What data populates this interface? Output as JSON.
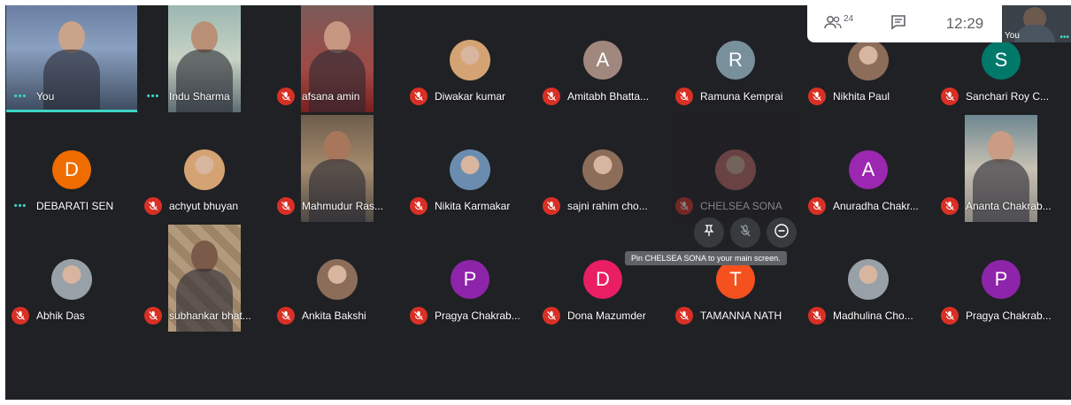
{
  "top_bar": {
    "participant_count": "24",
    "clock": "12:29",
    "self_label": "You",
    "people_icon": "people-icon",
    "chat_icon": "chat-icon"
  },
  "participants": [
    {
      "name": "You",
      "style": "video",
      "indicator": "more",
      "speaking": true
    },
    {
      "name": "Indu Sharma",
      "style": "video",
      "indicator": "more"
    },
    {
      "name": "afsana amin",
      "style": "video",
      "indicator": "muted"
    },
    {
      "name": "Diwakar kumar",
      "style": "photo",
      "indicator": "muted"
    },
    {
      "name": "Amitabh Bhatta...",
      "style": "initial",
      "initial": "A",
      "color": "#a1887f",
      "indicator": "muted"
    },
    {
      "name": "Ramuna Kemprai",
      "style": "initial",
      "initial": "R",
      "color": "#78909c",
      "indicator": "muted"
    },
    {
      "name": "Nikhita Paul",
      "style": "photo",
      "indicator": "muted"
    },
    {
      "name": "Sanchari Roy C...",
      "style": "initial",
      "initial": "S",
      "color": "#00796b",
      "indicator": "muted"
    },
    {
      "name": "DEBARATI SEN",
      "style": "initial",
      "initial": "D",
      "color": "#ef6c00",
      "indicator": "more"
    },
    {
      "name": "achyut bhuyan",
      "style": "photo",
      "indicator": "muted"
    },
    {
      "name": "Mahmudur Ras...",
      "style": "video",
      "indicator": "muted"
    },
    {
      "name": "Nikita Karmakar",
      "style": "photo",
      "indicator": "muted"
    },
    {
      "name": "sajni rahim cho...",
      "style": "photo",
      "indicator": "muted"
    },
    {
      "name": "CHELSEA SONA",
      "style": "photo",
      "indicator": "muted",
      "hovered": true
    },
    {
      "name": "Anuradha Chakr...",
      "style": "initial",
      "initial": "A",
      "color": "#9c27b0",
      "indicator": "muted"
    },
    {
      "name": "Ananta Chakrab...",
      "style": "video",
      "indicator": "muted"
    },
    {
      "name": "Abhik Das",
      "style": "photo",
      "indicator": "muted"
    },
    {
      "name": "subhankar bhat...",
      "style": "video",
      "indicator": "muted"
    },
    {
      "name": "Ankita Bakshi",
      "style": "photo",
      "indicator": "muted"
    },
    {
      "name": "Pragya Chakrab...",
      "style": "initial",
      "initial": "P",
      "color": "#8e24aa",
      "indicator": "muted"
    },
    {
      "name": "Dona Mazumder",
      "style": "initial",
      "initial": "D",
      "color": "#e91e63",
      "indicator": "muted"
    },
    {
      "name": "TAMANNA NATH",
      "style": "initial",
      "initial": "T",
      "color": "#f4511e",
      "indicator": "muted"
    },
    {
      "name": "Madhulina Cho...",
      "style": "photo",
      "indicator": "muted"
    },
    {
      "name": "Pragya Chakrab...",
      "style": "initial",
      "initial": "P",
      "color": "#8e24aa",
      "indicator": "muted"
    }
  ],
  "hover_controls": {
    "pin_icon": "pin-icon",
    "mute_icon": "mic-off-icon",
    "remove_icon": "remove-icon",
    "tooltip": "Pin CHELSEA SONA to your main screen."
  }
}
